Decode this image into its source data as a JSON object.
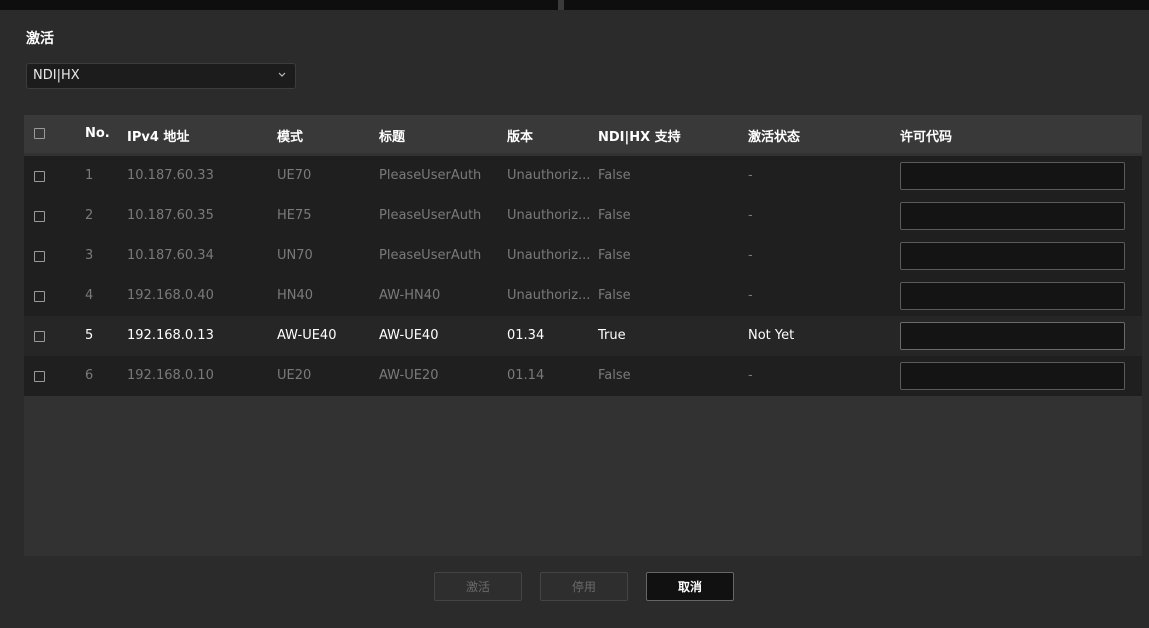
{
  "title": "激活",
  "select": {
    "value": "NDI|HX",
    "icon": "chevron-down-icon"
  },
  "columns": {
    "no": "No.",
    "ip": "IPv4 地址",
    "model": "模式",
    "name": "标题",
    "version": "版本",
    "ndi": "NDI|HX 支持",
    "status": "激活状态",
    "license": "许可代码"
  },
  "rows": [
    {
      "no": "1",
      "ip": "10.187.60.33",
      "model": "UE70",
      "name": "PleaseUserAuth",
      "version": "Unauthoriz...",
      "ndi": "False",
      "status": "-",
      "license": ""
    },
    {
      "no": "2",
      "ip": "10.187.60.35",
      "model": "HE75",
      "name": "PleaseUserAuth",
      "version": "Unauthoriz...",
      "ndi": "False",
      "status": "-",
      "license": ""
    },
    {
      "no": "3",
      "ip": "10.187.60.34",
      "model": "UN70",
      "name": "PleaseUserAuth",
      "version": "Unauthoriz...",
      "ndi": "False",
      "status": "-",
      "license": ""
    },
    {
      "no": "4",
      "ip": "192.168.0.40",
      "model": "HN40",
      "name": "AW-HN40",
      "version": "Unauthoriz...",
      "ndi": "False",
      "status": "-",
      "license": ""
    },
    {
      "no": "5",
      "ip": "192.168.0.13",
      "model": "AW-UE40",
      "name": "AW-UE40",
      "version": "01.34",
      "ndi": "True",
      "status": "Not Yet",
      "license": ""
    },
    {
      "no": "6",
      "ip": "192.168.0.10",
      "model": "UE20",
      "name": "AW-UE20",
      "version": "01.14",
      "ndi": "False",
      "status": "-",
      "license": ""
    }
  ],
  "buttons": {
    "activate": "激活",
    "disable": "停用",
    "cancel": "取消"
  }
}
